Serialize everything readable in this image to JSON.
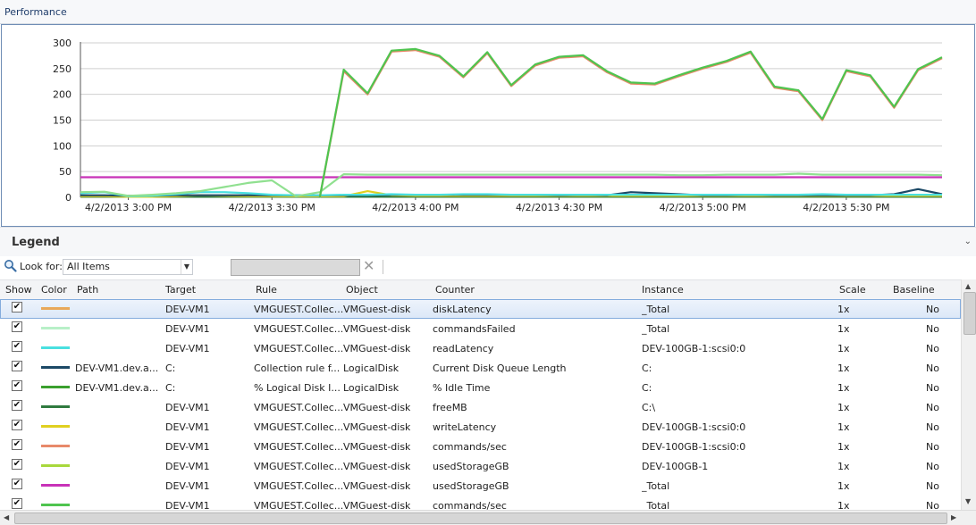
{
  "performance": {
    "title": "Performance"
  },
  "chart_data": {
    "type": "line",
    "ylim": [
      0,
      300
    ],
    "yticks": [
      "300",
      "250",
      "200",
      "150",
      "100",
      "50",
      "0"
    ],
    "xticks": [
      "4/2/2013 3:00 PM",
      "4/2/2013 3:30 PM",
      "4/2/2013 4:00 PM",
      "4/2/2013 4:30 PM",
      "4/2/2013 5:00 PM",
      "4/2/2013 5:30 PM"
    ],
    "x_minutes_after_3pm": [
      -10,
      -5,
      0,
      5,
      10,
      15,
      20,
      25,
      30,
      35,
      40,
      45,
      50,
      55,
      60,
      65,
      70,
      75,
      80,
      85,
      90,
      95,
      100,
      105,
      110,
      115,
      120,
      125,
      130,
      135,
      140,
      145,
      150,
      155,
      160,
      165,
      170
    ],
    "series": [
      {
        "color": "#4fc44f",
        "values": [
          null,
          null,
          null,
          null,
          null,
          null,
          null,
          null,
          null,
          null,
          0,
          248,
          202,
          285,
          288,
          275,
          235,
          282,
          218,
          258,
          273,
          276,
          245,
          223,
          221,
          237,
          252,
          265,
          283,
          215,
          208,
          152,
          247,
          237,
          176,
          249,
          272,
          268
        ]
      },
      {
        "color": "#e8896a",
        "values": [
          null,
          null,
          null,
          null,
          null,
          null,
          null,
          null,
          null,
          null,
          0,
          245,
          200,
          283,
          286,
          273,
          233,
          280,
          216,
          256,
          271,
          274,
          243,
          221,
          219,
          235,
          250,
          263,
          281,
          213,
          206,
          150,
          245,
          235,
          174,
          247,
          270,
          266
        ]
      },
      {
        "color": "#90e090",
        "values": [
          10,
          11,
          3,
          5,
          8,
          12,
          20,
          28,
          33,
          2,
          10,
          45,
          44,
          44,
          44,
          44,
          44,
          44,
          44,
          44,
          44,
          44,
          44,
          44,
          44,
          43,
          43,
          44,
          44,
          44,
          46,
          44,
          44,
          44,
          44,
          44,
          43,
          43
        ]
      },
      {
        "color": "#c832b8",
        "values": [
          39,
          39,
          39,
          39,
          39,
          39,
          39,
          39,
          39,
          39,
          39,
          39,
          39,
          39,
          39,
          39,
          39,
          39,
          39,
          39,
          39,
          39,
          39,
          39,
          39,
          39,
          39,
          39,
          39,
          39,
          39,
          39,
          39,
          39,
          39,
          39,
          39,
          39
        ]
      },
      {
        "color": "#49e0e0",
        "values": [
          8,
          10,
          2,
          3,
          6,
          10,
          10,
          8,
          5,
          4,
          4,
          5,
          5,
          6,
          5,
          5,
          6,
          6,
          5,
          5,
          5,
          5,
          5,
          5,
          5,
          5,
          5,
          5,
          5,
          5,
          5,
          6,
          5,
          5,
          5,
          5,
          5,
          4
        ]
      },
      {
        "color": "#1c4966",
        "values": [
          4,
          4,
          3,
          3,
          4,
          4,
          4,
          4,
          4,
          4,
          4,
          4,
          4,
          5,
          5,
          5,
          5,
          5,
          5,
          5,
          4,
          5,
          4,
          10,
          8,
          6,
          4,
          4,
          5,
          4,
          4,
          4,
          4,
          4,
          6,
          16,
          6,
          1
        ]
      },
      {
        "color": "#e0d020",
        "values": [
          2,
          2,
          1,
          1,
          2,
          4,
          3,
          2,
          2,
          2,
          2,
          2,
          12,
          4,
          3,
          3,
          3,
          3,
          3,
          3,
          3,
          3,
          3,
          3,
          3,
          3,
          3,
          3,
          3,
          3,
          3,
          3,
          3,
          3,
          3,
          3,
          3,
          2
        ]
      },
      {
        "color": "#2f7a3f",
        "values": [
          1,
          1,
          1,
          1,
          1,
          1,
          1,
          1,
          1,
          1,
          1,
          1,
          1,
          1,
          1,
          1,
          1,
          1,
          1,
          1,
          1,
          1,
          1,
          1,
          1,
          1,
          1,
          1,
          1,
          1,
          1,
          1,
          1,
          1,
          1,
          1,
          1,
          1
        ]
      }
    ]
  },
  "legend": {
    "title": "Legend"
  },
  "filter": {
    "look_for_label": "Look for:",
    "look_for_value": "All Items",
    "search_text": ""
  },
  "grid": {
    "columns": {
      "show": "Show",
      "color": "Color",
      "path": "Path",
      "target": "Target",
      "rule": "Rule",
      "object": "Object",
      "counter": "Counter",
      "instance": "Instance",
      "scale": "Scale",
      "baseline": "Baseline"
    },
    "rows": [
      {
        "checked": "✔",
        "color": "#e8a85a",
        "path": "",
        "target": "DEV-VM1",
        "rule": "VMGUEST.Collec...",
        "object": "VMGuest-disk",
        "counter": "diskLatency",
        "instance": "_Total",
        "scale": "1x",
        "baseline": "No"
      },
      {
        "checked": "✔",
        "color": "#b8f0c8",
        "path": "",
        "target": "DEV-VM1",
        "rule": "VMGUEST.Collec...",
        "object": "VMGuest-disk",
        "counter": "commandsFailed",
        "instance": "_Total",
        "scale": "1x",
        "baseline": "No"
      },
      {
        "checked": "✔",
        "color": "#49e0e0",
        "path": "",
        "target": "DEV-VM1",
        "rule": "VMGUEST.Collec...",
        "object": "VMGuest-disk",
        "counter": "readLatency",
        "instance": "DEV-100GB-1:scsi0:0",
        "scale": "1x",
        "baseline": "No"
      },
      {
        "checked": "✔",
        "color": "#1c4966",
        "path": "DEV-VM1.dev.a...",
        "target": "C:",
        "rule": "Collection rule f...",
        "object": "LogicalDisk",
        "counter": "Current Disk Queue Length",
        "instance": "C:",
        "scale": "1x",
        "baseline": "No"
      },
      {
        "checked": "✔",
        "color": "#3aa02e",
        "path": "DEV-VM1.dev.a...",
        "target": "C:",
        "rule": "% Logical Disk I...",
        "object": "LogicalDisk",
        "counter": "% Idle Time",
        "instance": "C:",
        "scale": "1x",
        "baseline": "No"
      },
      {
        "checked": "✔",
        "color": "#2f7a3f",
        "path": "",
        "target": "DEV-VM1",
        "rule": "VMGUEST.Collec...",
        "object": "VMGuest-disk",
        "counter": "freeMB",
        "instance": "C:\\",
        "scale": "1x",
        "baseline": "No"
      },
      {
        "checked": "✔",
        "color": "#e0d020",
        "path": "",
        "target": "DEV-VM1",
        "rule": "VMGUEST.Collec...",
        "object": "VMGuest-disk",
        "counter": "writeLatency",
        "instance": "DEV-100GB-1:scsi0:0",
        "scale": "1x",
        "baseline": "No"
      },
      {
        "checked": "✔",
        "color": "#e8896a",
        "path": "",
        "target": "DEV-VM1",
        "rule": "VMGUEST.Collec...",
        "object": "VMGuest-disk",
        "counter": "commands/sec",
        "instance": "DEV-100GB-1:scsi0:0",
        "scale": "1x",
        "baseline": "No"
      },
      {
        "checked": "✔",
        "color": "#a8d83c",
        "path": "",
        "target": "DEV-VM1",
        "rule": "VMGUEST.Collec...",
        "object": "VMGuest-disk",
        "counter": "usedStorageGB",
        "instance": "DEV-100GB-1",
        "scale": "1x",
        "baseline": "No"
      },
      {
        "checked": "✔",
        "color": "#c832b8",
        "path": "",
        "target": "DEV-VM1",
        "rule": "VMGUEST.Collec...",
        "object": "VMGuest-disk",
        "counter": "usedStorageGB",
        "instance": "_Total",
        "scale": "1x",
        "baseline": "No"
      },
      {
        "checked": "✔",
        "color": "#4fc44f",
        "path": "",
        "target": "DEV-VM1",
        "rule": "VMGUEST.Collec...",
        "object": "VMGuest-disk",
        "counter": "commands/sec",
        "instance": "_Total",
        "scale": "1x",
        "baseline": "No"
      }
    ]
  }
}
